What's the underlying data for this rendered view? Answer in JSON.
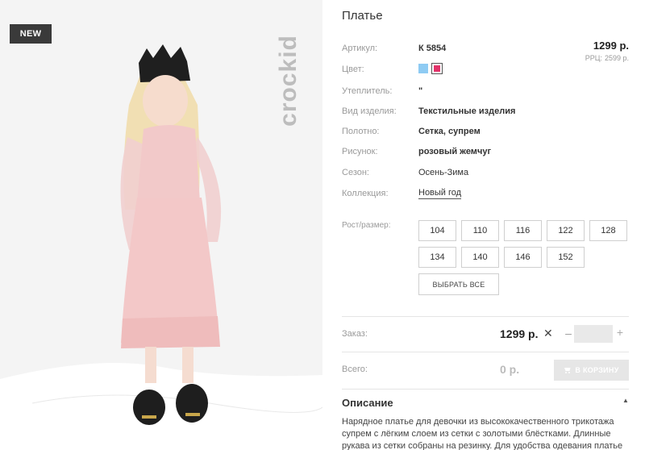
{
  "badge": "NEW",
  "brand": "crockid",
  "product": {
    "title": "Платье",
    "price": "1299 р.",
    "rrp_label": "РРЦ:",
    "rrp_value": "2599 р."
  },
  "attributes": [
    {
      "label": "Артикул:",
      "value": "К 5854"
    },
    {
      "label": "Цвет:",
      "value": ""
    },
    {
      "label": "Утеплитель:",
      "value": "\""
    },
    {
      "label": "Вид изделия:",
      "value": "Текстильные изделия"
    },
    {
      "label": "Полотно:",
      "value": "Сетка, супрем"
    },
    {
      "label": "Рисунок:",
      "value": "розовый жемчуг"
    },
    {
      "label": "Сезон:",
      "value": "Осень-Зима"
    },
    {
      "label": "Коллекция:",
      "value": "Новый год"
    }
  ],
  "colors": [
    "#8ecbf3",
    "#e2336a"
  ],
  "sizes": {
    "label": "Рост/размер:",
    "options": [
      "104",
      "110",
      "116",
      "122",
      "128",
      "134",
      "140",
      "146",
      "152"
    ],
    "select_all": "ВЫБРАТЬ ВСЕ"
  },
  "order": {
    "label": "Заказ:",
    "price": "1299 р.",
    "remove_icon": "✕",
    "minus": "–",
    "plus": "+",
    "quantity": ""
  },
  "total": {
    "label": "Всего:",
    "price": "0 р.",
    "cart_button": "В КОРЗИНУ",
    "cart_icon": "cart-icon"
  },
  "description": {
    "title": "Описание",
    "caret": "▲",
    "text": "Нарядное платье для девочки из высококачественного трикотажа супрем с лёгким слоем из сетки с золотыми блёстками. Длинные рукава из сетки собраны на резинку. Для удобства одевания платье"
  }
}
